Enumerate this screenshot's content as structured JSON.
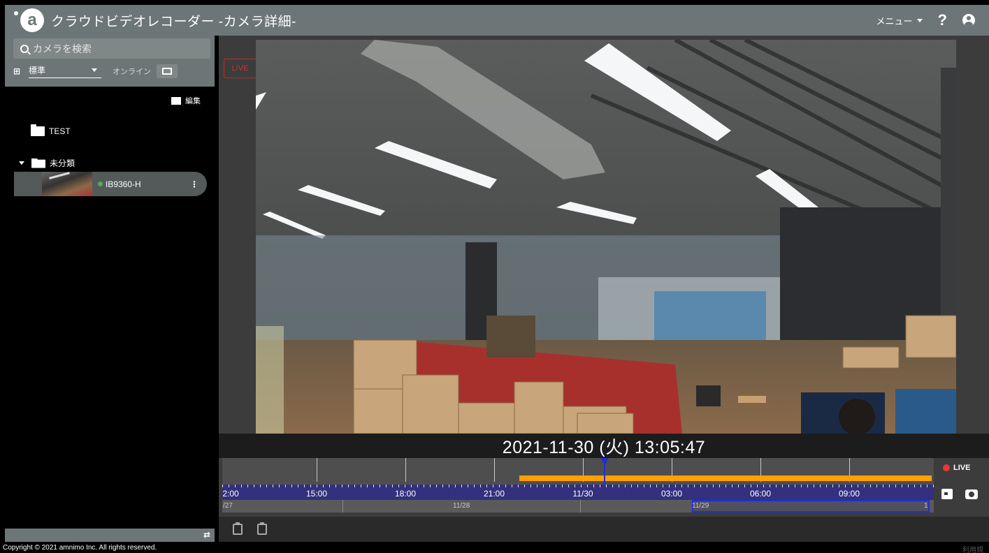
{
  "header": {
    "logo_letter": "a",
    "title": "クラウドビデオレコーダー -カメラ詳細-",
    "menu_label": "メニュー",
    "help_label": "?"
  },
  "sidebar": {
    "search_placeholder": "カメラを検索",
    "view_select_value": "標準",
    "online_toggle_label": "オンライン",
    "edit_label": "編集",
    "tree": {
      "folders": [
        {
          "name": "TEST",
          "expanded": false
        },
        {
          "name": "未分類",
          "expanded": true
        }
      ],
      "cameras": [
        {
          "name": "IB9360-H",
          "status": "online",
          "status_color": "#4caf50"
        }
      ]
    }
  },
  "viewer": {
    "live_badge": "LIVE",
    "timestamp": "2021-11-30 (火) 13:05:47",
    "live_button_label": "LIVE",
    "colors": {
      "recording": "#ffa000",
      "scale_bar": "#33307d",
      "playhead": "#1e2fd0",
      "live_red": "#e53935"
    },
    "timeline": {
      "time_labels": [
        "2:00",
        "15:00",
        "18:00",
        "21:00",
        "11/30",
        "03:00",
        "06:00",
        "09:00"
      ],
      "date_labels": [
        "/27",
        "11/28",
        "11/29",
        "1"
      ],
      "recording_range": {
        "start": "21:50",
        "end": "now"
      },
      "playhead_time": "13:05:47"
    }
  },
  "footer": {
    "copyright": "Copyright © 2021 amnimo Inc. All rights reserved.",
    "terms_link": "利用規"
  }
}
